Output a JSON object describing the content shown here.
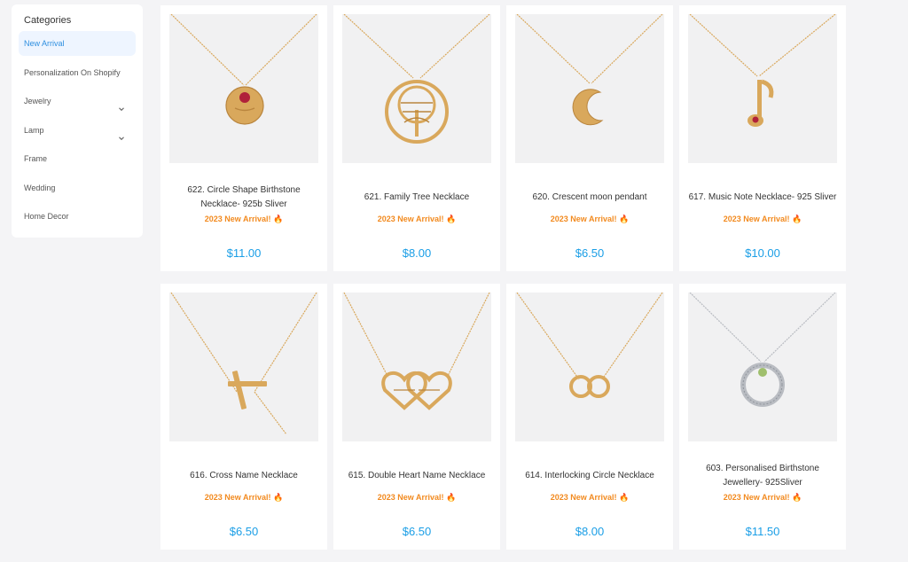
{
  "sidebar": {
    "title": "Categories",
    "items": [
      {
        "label": "New Arrival",
        "active": true,
        "expandable": false
      },
      {
        "label": "Personalization On Shopify",
        "active": false,
        "expandable": false
      },
      {
        "label": "Jewelry",
        "active": false,
        "expandable": true
      },
      {
        "label": "Lamp",
        "active": false,
        "expandable": true
      },
      {
        "label": "Frame",
        "active": false,
        "expandable": false
      },
      {
        "label": "Wedding",
        "active": false,
        "expandable": false
      },
      {
        "label": "Home Decor",
        "active": false,
        "expandable": false
      }
    ]
  },
  "products": [
    {
      "name": "622. Circle Shape Birthstone Necklace- 925b Sliver",
      "badge": "2023 New Arrival! 🔥",
      "price": "$11.00",
      "image": "circle-birthstone-pendant"
    },
    {
      "name": "621. Family Tree Necklace",
      "badge": "2023 New Arrival! 🔥",
      "price": "$8.00",
      "image": "family-tree-pendant"
    },
    {
      "name": "620. Crescent moon pendant",
      "badge": "2023 New Arrival! 🔥",
      "price": "$6.50",
      "image": "crescent-moon-pendant"
    },
    {
      "name": "617. Music Note Necklace- 925 Sliver",
      "badge": "2023 New Arrival! 🔥",
      "price": "$10.00",
      "image": "music-note-pendant"
    },
    {
      "name": "616. Cross Name Necklace",
      "badge": "2023 New Arrival! 🔥",
      "price": "$6.50",
      "image": "cross-pendant"
    },
    {
      "name": "615. Double Heart Name Necklace",
      "badge": "2023 New Arrival! 🔥",
      "price": "$6.50",
      "image": "double-heart-pendant"
    },
    {
      "name": "614. Interlocking Circle Necklace",
      "badge": "2023 New Arrival! 🔥",
      "price": "$8.00",
      "image": "interlocking-circles-pendant"
    },
    {
      "name": "603. Personalised Birthstone Jewellery- 925Sliver",
      "badge": "2023 New Arrival! 🔥",
      "price": "$11.50",
      "image": "silver-birthstone-ring-pendant"
    }
  ],
  "colors": {
    "accent": "#2e8fe0",
    "price": "#1a9ee6",
    "badge": "#f28a1f",
    "gold": "#d9a85c",
    "silver": "#b9bcc2"
  }
}
